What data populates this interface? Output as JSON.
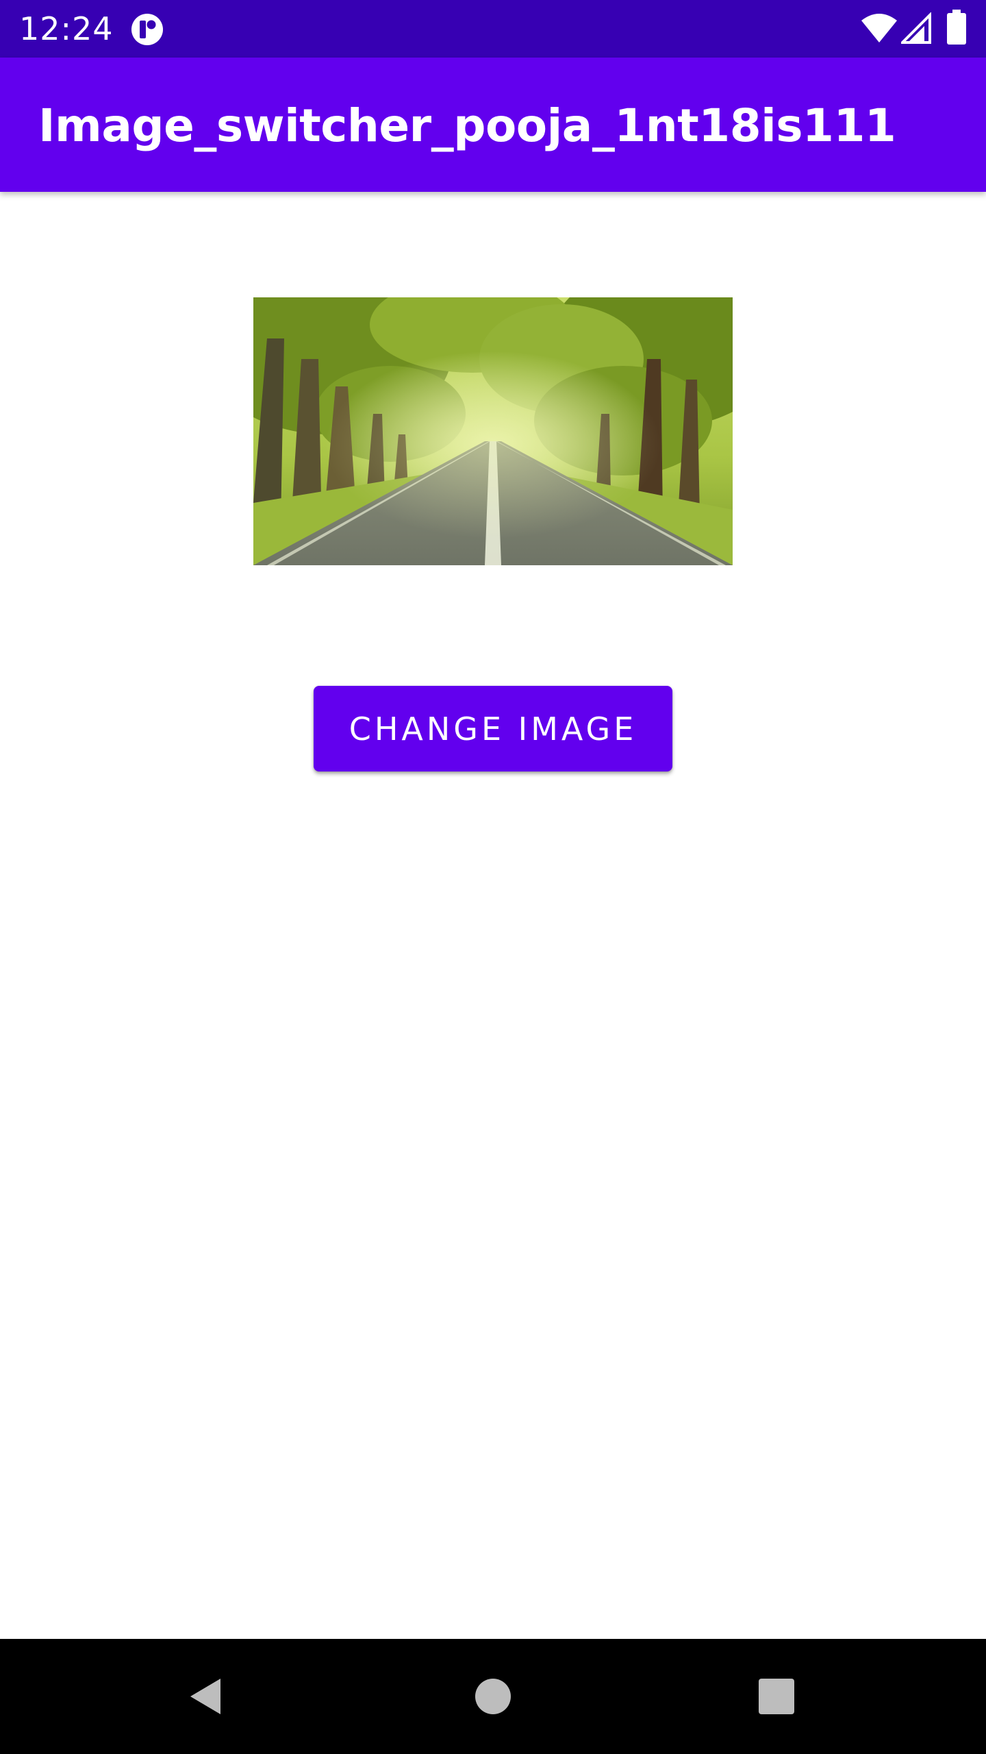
{
  "status_bar": {
    "time": "12:24",
    "icons": [
      "notification-app-icon",
      "wifi-icon",
      "signal-icon",
      "battery-icon"
    ]
  },
  "app_bar": {
    "title": "Image_switcher_pooja_1nt18is111"
  },
  "main": {
    "image": {
      "description_icon": "road-through-trees-image"
    },
    "change_image_button": {
      "label": "CHANGE IMAGE"
    }
  },
  "nav_bar": {
    "icons": [
      "back-icon",
      "home-icon",
      "recents-icon"
    ]
  },
  "colors": {
    "status_bar": "#3700B3",
    "primary": "#6200EE",
    "background": "#FFFFFF",
    "nav_bar": "#000000"
  }
}
